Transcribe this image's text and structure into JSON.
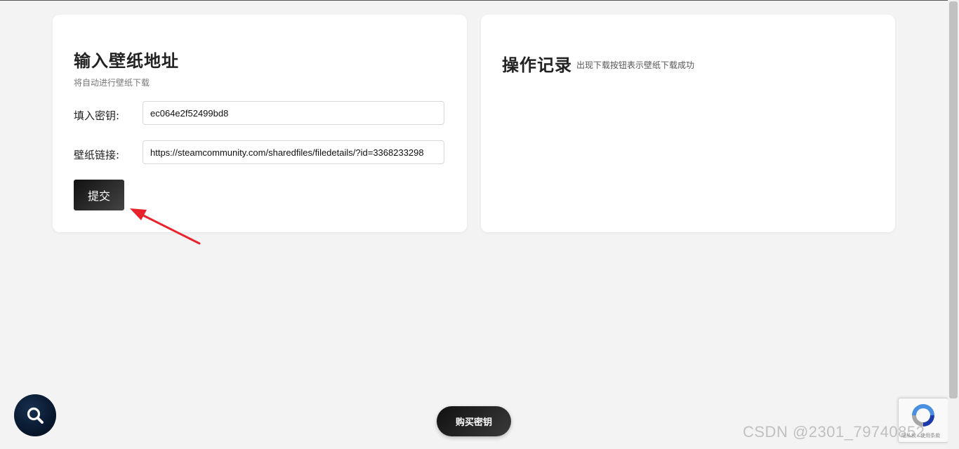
{
  "left_card": {
    "title": "输入壁纸地址",
    "subtitle": "将自动进行壁纸下载",
    "key_label": "填入密钥:",
    "key_value": "ec064e2f52499bd8",
    "link_label": "壁纸链接:",
    "link_value": "https://steamcommunity.com/sharedfiles/filedetails/?id=3368233298",
    "submit_label": "提交"
  },
  "right_card": {
    "title": "操作记录",
    "subtitle": "出现下载按钮表示壁纸下载成功"
  },
  "floating": {
    "search_icon": "search-icon",
    "buy_label": "购买密钥"
  },
  "recaptcha": {
    "text": "隐私权 - 使用条款"
  },
  "watermark": "CSDN @2301_79740852",
  "colors": {
    "background": "#f3f3f3",
    "card": "#ffffff",
    "button_dark": "#111111",
    "arrow": "#e8232b",
    "search_fab": "#061428"
  }
}
